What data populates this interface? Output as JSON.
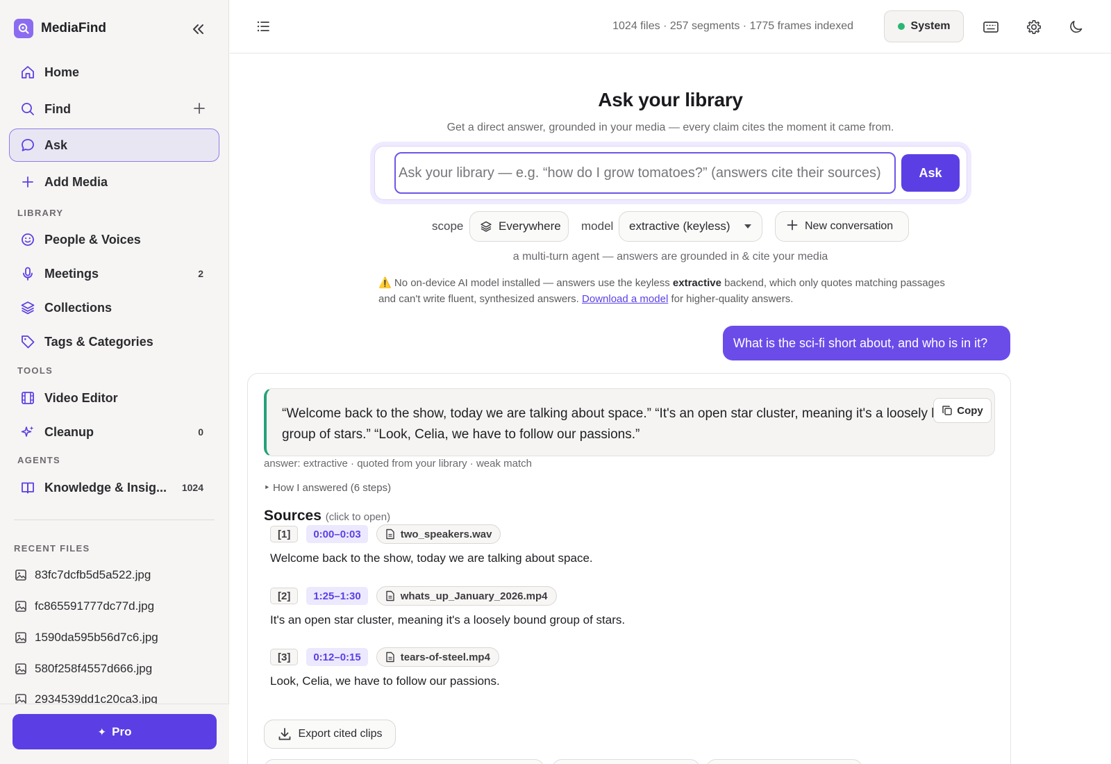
{
  "app": {
    "name": "MediaFind"
  },
  "nav": {
    "home": "Home",
    "find": "Find",
    "ask": "Ask",
    "add_media": "Add Media",
    "library_label": "LIBRARY",
    "people": "People & Voices",
    "meetings": "Meetings",
    "meetings_count": "2",
    "collections": "Collections",
    "tags": "Tags & Categories",
    "tools_label": "TOOLS",
    "video_editor": "Video Editor",
    "cleanup": "Cleanup",
    "cleanup_count": "0",
    "agents_label": "AGENTS",
    "knowledge": "Knowledge & Insig...",
    "knowledge_count": "1024"
  },
  "recent": {
    "label": "RECENT FILES",
    "files": [
      "83fc7dcfb5d5a522.jpg",
      "fc865591777dc77d.jpg",
      "1590da595b56d7c6.jpg",
      "580f258f4557d666.jpg",
      "2934539dd1c20ca3.jpg"
    ]
  },
  "pro": {
    "label": "Pro"
  },
  "topbar": {
    "stats": "1024 files · 257 segments · 1775 frames indexed",
    "system": "System",
    "status_color": "#2bb673"
  },
  "main": {
    "title": "Ask your library",
    "subtitle": "Get a direct answer, grounded in your media — every claim cites the moment it came from.",
    "search_placeholder": "Ask your library — e.g. “how do I grow tomatoes?” (answers cite their sources)",
    "ask_button": "Ask",
    "scope_label": "scope",
    "scope_value": "Everywhere",
    "model_label": "model",
    "model_value": "extractive (keyless)",
    "new_conversation": "New conversation",
    "caption": "a multi-turn agent — answers are grounded in & cite your media",
    "warning_icon": "⚠️",
    "warning_pre": "No on-device AI model installed — answers use the keyless",
    "warning_bold": "extractive",
    "warning_mid": "backend, which only quotes matching passages and can't write fluent, synthesized answers.",
    "warning_link": "Download a model",
    "warning_post": "for higher-quality answers."
  },
  "conversation": {
    "user_message": "What is the sci-fi short about, and who is in it?",
    "answer_quote": "“Welcome back to the show, today we are talking about space.” “It's an open star cluster, meaning it's a loosely bound group of stars.” “Look, Celia, we have to follow our passions.”",
    "copy_label": "Copy",
    "answer_meta": "answer: extractive · quoted from your library · weak match",
    "how_answered": "‣ How I answered (6 steps)",
    "sources_title": "Sources",
    "sources_hint": "(click to open)",
    "sources": [
      {
        "index": "[1]",
        "time": "0:00–0:03",
        "file": "two_speakers.wav",
        "text": "Welcome back to the show, today we are talking about space."
      },
      {
        "index": "[2]",
        "time": "1:25–1:30",
        "file": "whats_up_January_2026.mp4",
        "text": "It's an open star cluster, meaning it's a loosely bound group of stars."
      },
      {
        "index": "[3]",
        "time": "0:12–0:15",
        "file": "tears-of-steel.mp4",
        "text": "Look, Celia, we have to follow our passions."
      }
    ],
    "export_label": "Export cited clips"
  },
  "colors": {
    "accent": "#5b3fe4",
    "quote_border": "#22a37a"
  }
}
